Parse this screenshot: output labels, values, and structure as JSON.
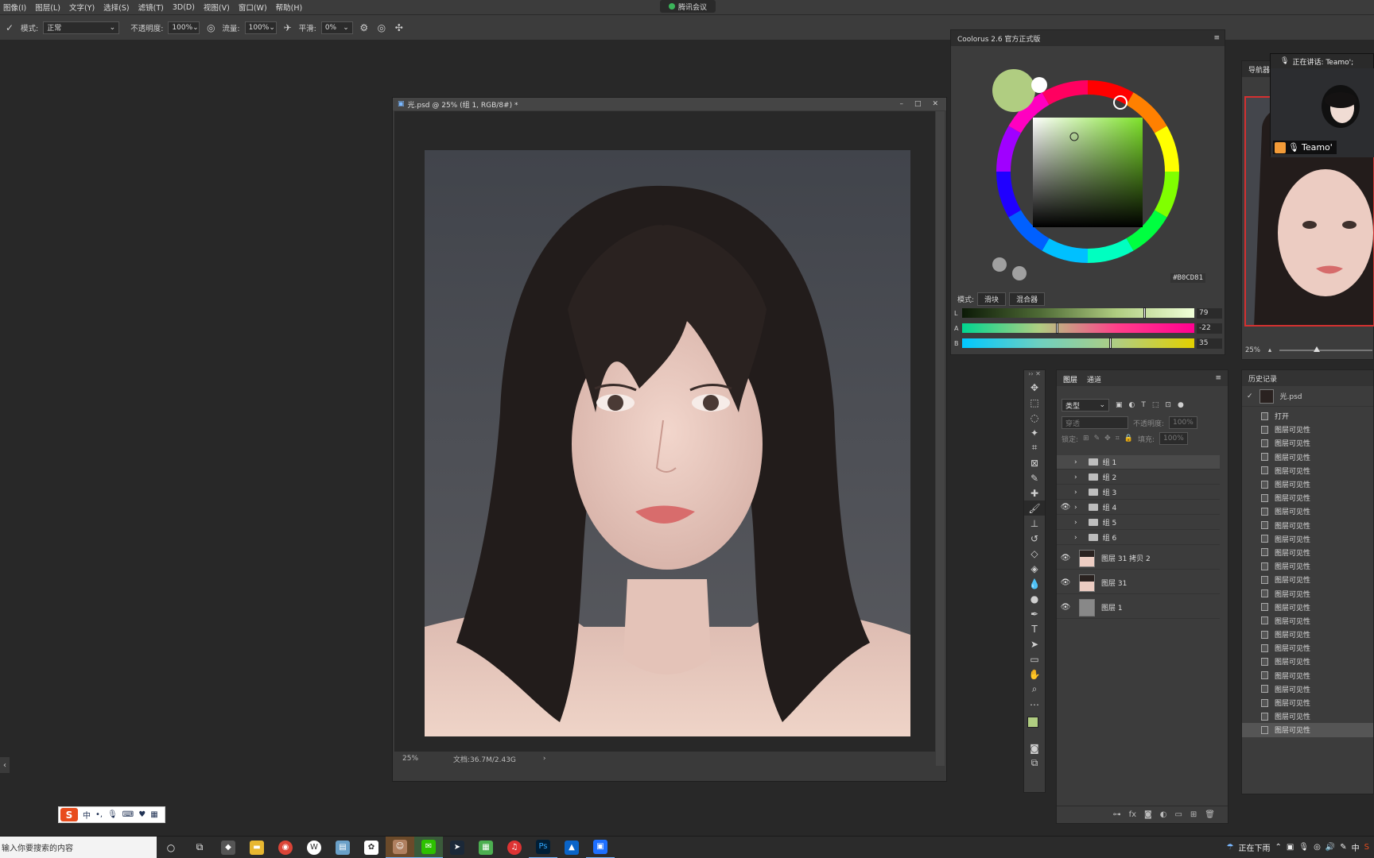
{
  "menu": [
    "图像(I)",
    "图层(L)",
    "文字(Y)",
    "选择(S)",
    "滤镜(T)",
    "3D(D)",
    "视图(V)",
    "窗口(W)",
    "帮助(H)"
  ],
  "meeting_pill": "腾讯会议",
  "options": {
    "mode_label": "模式:",
    "mode_value": "正常",
    "opacity_label": "不透明度:",
    "opacity_value": "100%",
    "flow_label": "流量:",
    "flow_value": "100%",
    "smooth_label": "平滑:",
    "smooth_value": "0%"
  },
  "document": {
    "title": "光.psd @ 25% (组 1, RGB/8#) *",
    "zoom": "25%",
    "doc_size": "文档:36.7M/2.43G",
    "status_arrow": "›"
  },
  "coolorus": {
    "title": "Coolorus 2.6 官方正式版",
    "hex": "#B0CD81",
    "mode_label": "模式:",
    "mode_slider": "滑块",
    "mode_mixer": "混合器",
    "sliders": [
      {
        "channel": "L",
        "value": "79",
        "fraction": 0.79
      },
      {
        "channel": "A",
        "value": "-22",
        "fraction": 0.41
      },
      {
        "channel": "B",
        "value": "35",
        "fraction": 0.64
      }
    ],
    "swatch_color": "#b0cd81"
  },
  "navigator": {
    "title": "导航器",
    "zoom": "25%",
    "zoom_fraction": 0.37
  },
  "meeting": {
    "speaking_label": "正在讲话: Teamo';",
    "name": "Teamo'"
  },
  "tools": [
    "move-tool-icon",
    "marquee-tool-icon",
    "lasso-tool-icon",
    "magic-wand-tool-icon",
    "crop-tool-icon",
    "frame-tool-icon",
    "eyedropper-tool-icon",
    "healing-tool-icon",
    "brush-tool-icon",
    "stamp-tool-icon",
    "history-brush-tool-icon",
    "eraser-tool-icon",
    "bucket-tool-icon",
    "blur-tool-icon",
    "dodge-tool-icon",
    "pen-tool-icon",
    "type-tool-icon",
    "path-select-tool-icon",
    "rectangle-tool-icon",
    "hand-tool-icon",
    "zoom-tool-icon",
    "more-tools-icon"
  ],
  "layers": {
    "tab_layers": "图层",
    "tab_channels": "通道",
    "filter_kind": "类型",
    "blend": "穿透",
    "opacity_label": "不透明度:",
    "opacity_value": "100%",
    "lock_label": "锁定:",
    "fill_label": "填充:",
    "fill_value": "100%",
    "groups": [
      {
        "name": "组 1",
        "visible": false,
        "selected": true
      },
      {
        "name": "组 2",
        "visible": false,
        "selected": false
      },
      {
        "name": "组 3",
        "visible": false,
        "selected": false
      },
      {
        "name": "组 4",
        "visible": true,
        "selected": false
      },
      {
        "name": "组 5",
        "visible": false,
        "selected": false
      },
      {
        "name": "组 6",
        "visible": false,
        "selected": false
      }
    ],
    "pixel_layers": [
      {
        "name": "图层 31 拷贝 2",
        "visible": true
      },
      {
        "name": "图层 31",
        "visible": true
      },
      {
        "name": "图层 1",
        "visible": true
      }
    ]
  },
  "history": {
    "title": "历史记录",
    "snapshot": "光.psd",
    "items": [
      "打开",
      "图层可见性",
      "图层可见性",
      "图层可见性",
      "图层可见性",
      "图层可见性",
      "图层可见性",
      "图层可见性",
      "图层可见性",
      "图层可见性",
      "图层可见性",
      "图层可见性",
      "图层可见性",
      "图层可见性",
      "图层可见性",
      "图层可见性",
      "图层可见性",
      "图层可见性",
      "图层可见性",
      "图层可见性",
      "图层可见性",
      "图层可见性",
      "图层可见性",
      "图层可见性"
    ],
    "selected_index": 23
  },
  "ime": {
    "logo": "S",
    "lang": "中"
  },
  "taskbar": {
    "search_placeholder": "输入你要搜索的内容",
    "weather": "正在下雨",
    "lang": "中"
  }
}
